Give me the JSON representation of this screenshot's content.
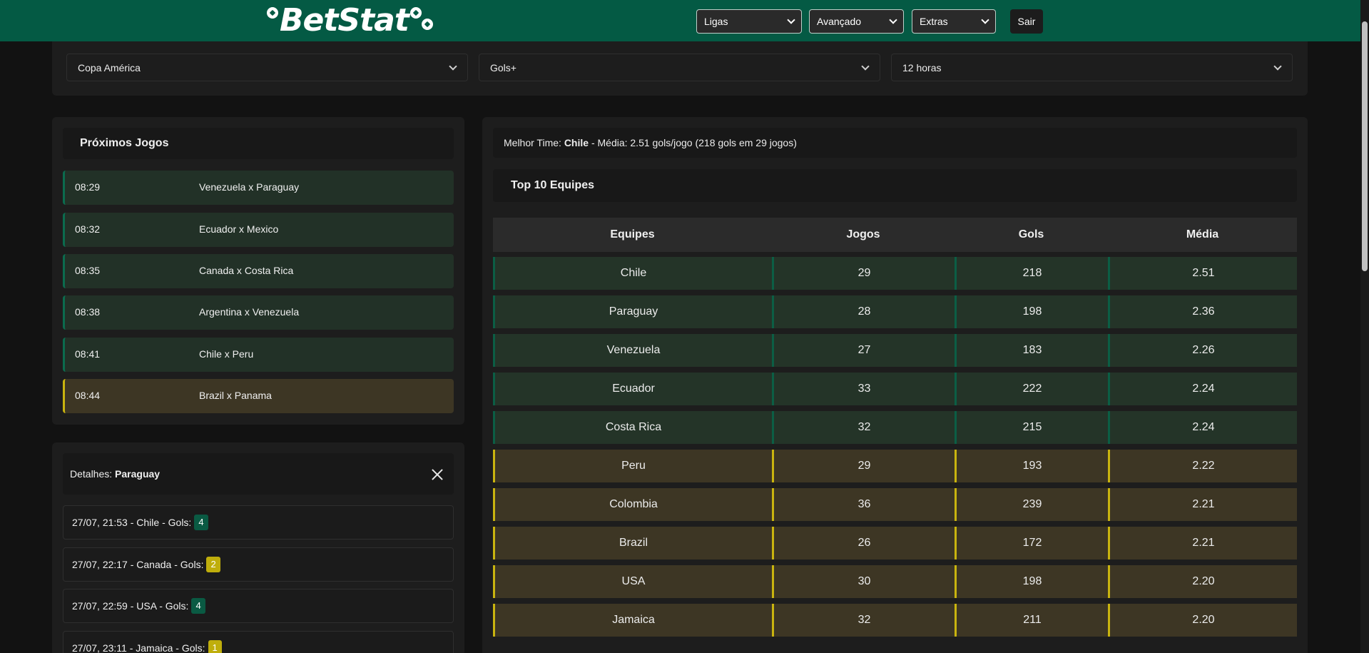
{
  "brand": {
    "name": "BetStat"
  },
  "nav": {
    "ligas": "Ligas",
    "avancado": "Avançado",
    "extras": "Extras",
    "sair": "Sair"
  },
  "filters": {
    "league": "Copa América",
    "market": "Gols+",
    "period": "12 horas"
  },
  "proximos": {
    "title": "Próximos Jogos",
    "games": [
      {
        "time": "08:29",
        "match": "Venezuela x Paraguay",
        "status": "normal"
      },
      {
        "time": "08:32",
        "match": "Ecuador x Mexico",
        "status": "normal"
      },
      {
        "time": "08:35",
        "match": "Canada x Costa Rica",
        "status": "normal"
      },
      {
        "time": "08:38",
        "match": "Argentina x Venezuela",
        "status": "normal"
      },
      {
        "time": "08:41",
        "match": "Chile x Peru",
        "status": "normal"
      },
      {
        "time": "08:44",
        "match": "Brazil x Panama",
        "status": "warn"
      }
    ]
  },
  "detalhes": {
    "label": "Detalhes:",
    "team": "Paraguay",
    "goals_label": "Gols:",
    "items": [
      {
        "text": "27/07, 21:53 - Chile -",
        "goals": "4",
        "color": "green"
      },
      {
        "text": "27/07, 22:17 - Canada -",
        "goals": "2",
        "color": "yellow"
      },
      {
        "text": "27/07, 22:59 - USA -",
        "goals": "4",
        "color": "green"
      },
      {
        "text": "27/07, 23:11 - Jamaica -",
        "goals": "1",
        "color": "yellow"
      }
    ]
  },
  "melhor": {
    "label": "Melhor Time:",
    "team": "Chile",
    "text": "- Média: 2.51 gols/jogo (218 gols em 29 jogos)"
  },
  "top10": {
    "title": "Top 10 Equipes",
    "headers": [
      "Equipes",
      "Jogos",
      "Gols",
      "Média"
    ],
    "rows": [
      {
        "team": "Chile",
        "jogos": "29",
        "gols": "218",
        "media": "2.51",
        "status": "normal"
      },
      {
        "team": "Paraguay",
        "jogos": "28",
        "gols": "198",
        "media": "2.36",
        "status": "normal"
      },
      {
        "team": "Venezuela",
        "jogos": "27",
        "gols": "183",
        "media": "2.26",
        "status": "normal"
      },
      {
        "team": "Ecuador",
        "jogos": "33",
        "gols": "222",
        "media": "2.24",
        "status": "normal"
      },
      {
        "team": "Costa Rica",
        "jogos": "32",
        "gols": "215",
        "media": "2.24",
        "status": "normal"
      },
      {
        "team": "Peru",
        "jogos": "29",
        "gols": "193",
        "media": "2.22",
        "status": "warn"
      },
      {
        "team": "Colombia",
        "jogos": "36",
        "gols": "239",
        "media": "2.21",
        "status": "warn"
      },
      {
        "team": "Brazil",
        "jogos": "26",
        "gols": "172",
        "media": "2.21",
        "status": "warn"
      },
      {
        "team": "USA",
        "jogos": "30",
        "gols": "198",
        "media": "2.20",
        "status": "warn"
      },
      {
        "team": "Jamaica",
        "jogos": "32",
        "gols": "211",
        "media": "2.20",
        "status": "warn"
      }
    ]
  },
  "colors": {
    "header_bg": "#045a44",
    "ok_accent": "#0b6b4e",
    "warn_accent": "#c9b40f"
  }
}
